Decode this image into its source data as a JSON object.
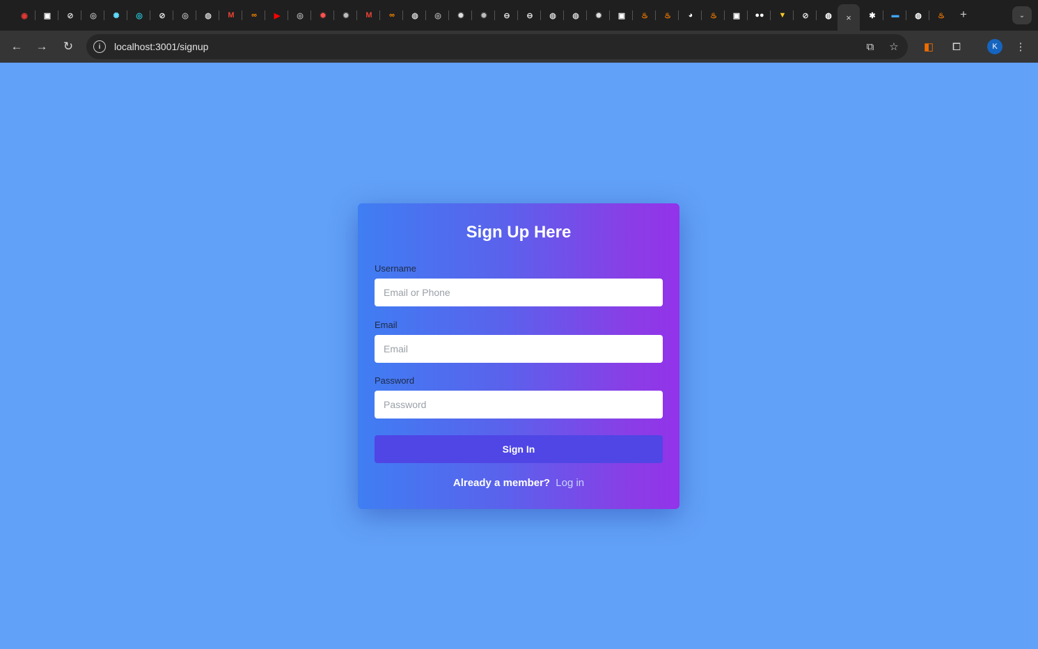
{
  "browser": {
    "url": "localhost:3001/signup",
    "active_tab_close": "×",
    "new_tab": "+",
    "profile_initial": "K",
    "favicons": [
      {
        "icon": "record-icon",
        "glyph": "◉",
        "color": "#e53935"
      },
      {
        "icon": "notion-icon",
        "glyph": "▣",
        "color": "#ffffff"
      },
      {
        "icon": "globe-icon",
        "glyph": "⊘",
        "color": "#d0d0d0"
      },
      {
        "icon": "openai-icon",
        "glyph": "◎",
        "color": "#b0b0b0"
      },
      {
        "icon": "react-icon",
        "glyph": "✺",
        "color": "#61dafb"
      },
      {
        "icon": "radar-icon",
        "glyph": "◎",
        "color": "#26c6da"
      },
      {
        "icon": "compass-icon",
        "glyph": "⊘",
        "color": "#e0e0e0"
      },
      {
        "icon": "openai-icon",
        "glyph": "◎",
        "color": "#b0b0b0"
      },
      {
        "icon": "github-icon",
        "glyph": "◍",
        "color": "#d0d0d0"
      },
      {
        "icon": "gmail-icon",
        "glyph": "M",
        "color": "#ea4335"
      },
      {
        "icon": "infinity-icon",
        "glyph": "∞",
        "color": "#ff8a00"
      },
      {
        "icon": "youtube-icon",
        "glyph": "▶",
        "color": "#ff0000"
      },
      {
        "icon": "openai-icon",
        "glyph": "◎",
        "color": "#b0b0b0"
      },
      {
        "icon": "sun-icon",
        "glyph": "✹",
        "color": "#ff5252"
      },
      {
        "icon": "gear-icon",
        "glyph": "✹",
        "color": "#bdbdbd"
      },
      {
        "icon": "gmail-icon",
        "glyph": "M",
        "color": "#ea4335"
      },
      {
        "icon": "infinity-icon",
        "glyph": "∞",
        "color": "#ff8a00"
      },
      {
        "icon": "github-icon",
        "glyph": "◍",
        "color": "#d0d0d0"
      },
      {
        "icon": "openai-icon",
        "glyph": "◎",
        "color": "#b0b0b0"
      },
      {
        "icon": "gear-icon",
        "glyph": "✹",
        "color": "#e0e0e0"
      },
      {
        "icon": "gear-icon",
        "glyph": "✹",
        "color": "#bdbdbd"
      },
      {
        "icon": "circle-icon",
        "glyph": "⊖",
        "color": "#e0e0e0"
      },
      {
        "icon": "circle-icon",
        "glyph": "⊖",
        "color": "#e0e0e0"
      },
      {
        "icon": "github-icon",
        "glyph": "◍",
        "color": "#d0d0d0"
      },
      {
        "icon": "github-icon",
        "glyph": "◍",
        "color": "#d0d0d0"
      },
      {
        "icon": "gear-icon",
        "glyph": "✹",
        "color": "#e0e0e0"
      },
      {
        "icon": "notion-icon",
        "glyph": "▣",
        "color": "#ffffff"
      },
      {
        "icon": "java-icon",
        "glyph": "♨",
        "color": "#f57c00"
      },
      {
        "icon": "java-icon",
        "glyph": "♨",
        "color": "#f57c00"
      },
      {
        "icon": "chrome-icon",
        "glyph": "◕",
        "color": "#ffffff"
      },
      {
        "icon": "java-icon",
        "glyph": "♨",
        "color": "#f57c00"
      },
      {
        "icon": "notion-icon",
        "glyph": "▣",
        "color": "#ffffff"
      },
      {
        "icon": "medium-icon",
        "glyph": "●●",
        "color": "#ffffff"
      },
      {
        "icon": "vue-icon",
        "glyph": "▼",
        "color": "#ffca28"
      },
      {
        "icon": "compass-icon",
        "glyph": "⊘",
        "color": "#e0e0e0"
      },
      {
        "icon": "github-icon",
        "glyph": "◍",
        "color": "#ffffff"
      }
    ],
    "favicons_after": [
      {
        "icon": "pin-icon",
        "glyph": "✱",
        "color": "#ffffff"
      },
      {
        "icon": "minus-icon",
        "glyph": "▬",
        "color": "#42a5f5"
      },
      {
        "icon": "github-icon",
        "glyph": "◍",
        "color": "#ffffff"
      },
      {
        "icon": "java-icon",
        "glyph": "♨",
        "color": "#f57c00"
      }
    ]
  },
  "form": {
    "title": "Sign Up Here",
    "username_label": "Username",
    "username_placeholder": "Email or Phone",
    "email_label": "Email",
    "email_placeholder": "Email",
    "password_label": "Password",
    "password_placeholder": "Password",
    "submit_label": "Sign In",
    "footer_text": "Already a member?",
    "login_link": "Log in"
  },
  "colors": {
    "page_background": "#62a1f8",
    "card_gradient_start": "#3f7ef3",
    "card_gradient_end": "#9333ea",
    "button": "#4f46e5"
  }
}
